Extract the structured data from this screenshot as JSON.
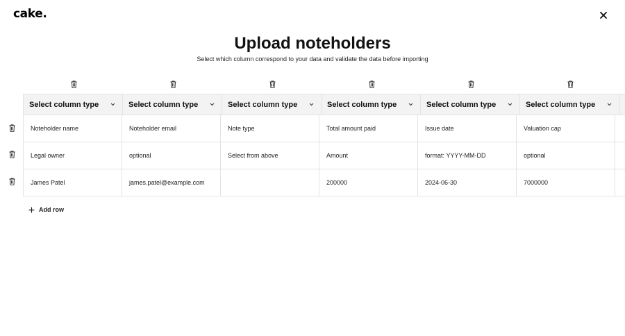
{
  "brand": {
    "logo": "cake."
  },
  "page": {
    "title": "Upload noteholders",
    "subtitle": "Select which column correspond to your data and validate the data before importing"
  },
  "columns": [
    {
      "type_label": "Select column type"
    },
    {
      "type_label": "Select column type"
    },
    {
      "type_label": "Select column type"
    },
    {
      "type_label": "Select column type"
    },
    {
      "type_label": "Select column type"
    },
    {
      "type_label": "Select column type"
    }
  ],
  "rows": [
    {
      "cells": [
        "Noteholder name",
        "Noteholder email",
        "Note type",
        "Total amount paid",
        "Issue date",
        "Valuation cap"
      ]
    },
    {
      "cells": [
        "Legal owner",
        "optional",
        "Select from above",
        "Amount",
        "format: YYYY-MM-DD",
        "optional"
      ]
    },
    {
      "cells": [
        "James Patel",
        "james.patel@example.com",
        "",
        "200000",
        "2024-06-30",
        "7000000"
      ]
    }
  ],
  "actions": {
    "add_row": "Add row"
  },
  "icons": {
    "close": "close-icon",
    "trash": "trash-icon",
    "chevron": "chevron-down-icon",
    "plus": "plus-icon"
  }
}
